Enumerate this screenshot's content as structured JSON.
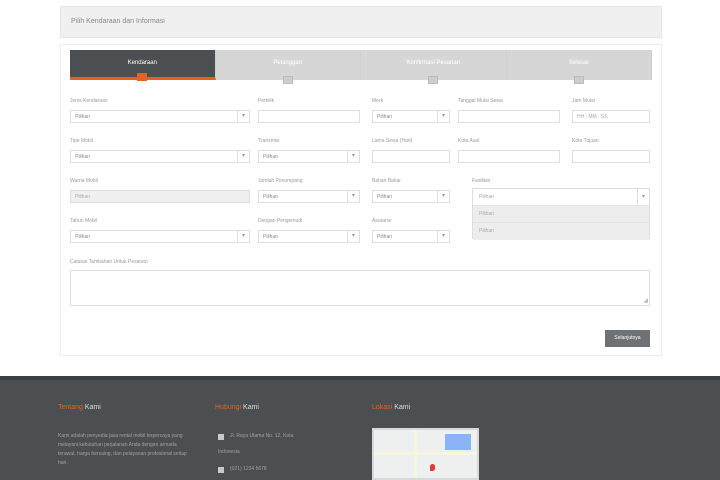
{
  "header": {
    "title": "Pilih Kendaraan dan Informasi"
  },
  "steps": [
    {
      "label": "Kendaraan",
      "active": true
    },
    {
      "label": "Pelanggan",
      "active": false
    },
    {
      "label": "Konfirmasi Pesanan",
      "active": false
    },
    {
      "label": "Selesai",
      "active": false
    }
  ],
  "form": {
    "row1": {
      "jenis_kendaraan": {
        "label": "Jenis Kendaraan",
        "value": "Pilihan"
      },
      "pemilik": {
        "label": "Pemilik",
        "value": ""
      },
      "merk": {
        "label": "Merk",
        "value": "Pilihan"
      },
      "tanggal": {
        "label": "Tanggal Mulai Sewa",
        "value": ""
      },
      "jam": {
        "label": "Jam Mulai",
        "value": "HH : MM : SS"
      }
    },
    "row2": {
      "tipe": {
        "label": "Tipe Mobil",
        "value": "Pilihan"
      },
      "transmisi": {
        "label": "Transmisi",
        "value": "Pilihan"
      },
      "lama_sewa": {
        "label": "Lama Sewa (Hari)",
        "value": ""
      },
      "kota_asal": {
        "label": "Kota Asal",
        "value": ""
      },
      "kota_tujuan": {
        "label": "Kota Tujuan",
        "value": ""
      }
    },
    "row3": {
      "warna": {
        "label": "Warna Mobil",
        "value": "Pilihan"
      },
      "jumlah_penumpang": {
        "label": "Jumlah Penumpang",
        "value": "Pilihan"
      },
      "bahan_bakar": {
        "label": "Bahan Bakar",
        "value": "Pilihan"
      },
      "fasilitas": {
        "label": "Fasilitas",
        "value": "Pilihan",
        "options": [
          "Pilihan",
          "Pilihan"
        ]
      }
    },
    "row4": {
      "tahun": {
        "label": "Tahun Mobil",
        "value": "Pilihan"
      },
      "pengemudi": {
        "label": "Dengan Pengemudi",
        "value": "Pilihan"
      },
      "asuransi": {
        "label": "Asuransi",
        "value": "Pilihan"
      }
    },
    "notes": {
      "label": "Catatan Tambahan Untuk Pesanan"
    },
    "next_label": "Selanjutnya"
  },
  "footer": {
    "about": {
      "head_accent": "Tentang",
      "head_rest": "Kami",
      "text": "Kami adalah penyedia jasa rental mobil terpercaya yang melayani kebutuhan perjalanan Anda dengan armada terawat, harga bersaing, dan pelayanan profesional setiap hari."
    },
    "contact": {
      "head_accent": "Hubungi",
      "head_rest": "Kami",
      "address": "Jl. Raya Utama No. 12, Kota",
      "address2": "Indonesia",
      "phone": "(021) 1234 5678"
    },
    "location": {
      "head_accent": "Lokasi",
      "head_rest": "Kami"
    }
  },
  "colors": {
    "accent": "#e8601c",
    "dark": "#4c4f51",
    "footer": "#4b4f52"
  }
}
